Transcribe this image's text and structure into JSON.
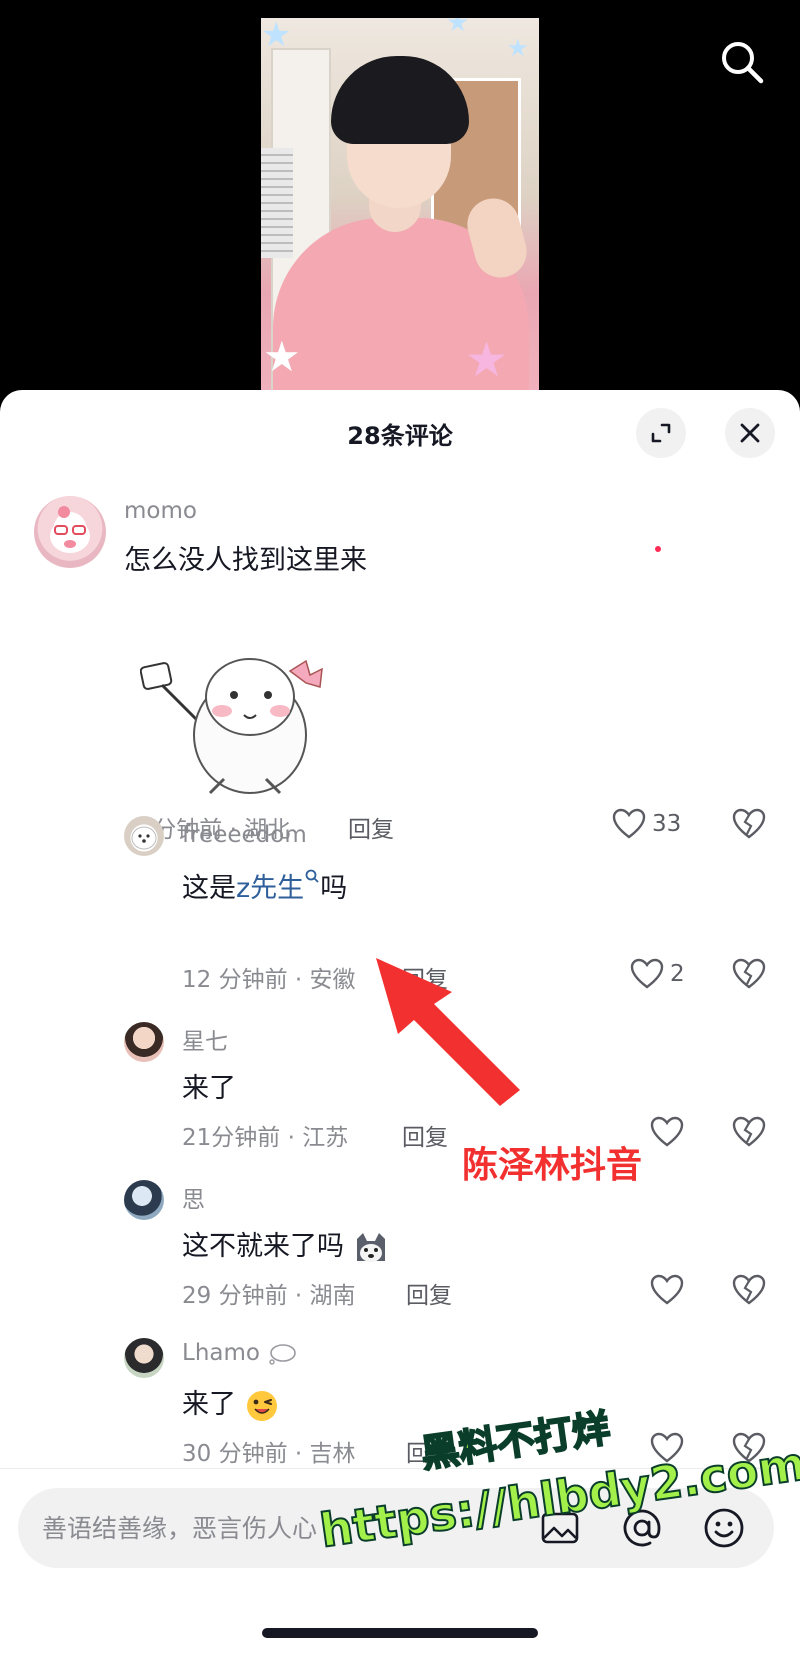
{
  "header": {
    "search_icon": "search-icon"
  },
  "sheet": {
    "title": "28条评论",
    "expand_icon": "expand-icon",
    "close_icon": "close-icon"
  },
  "comments": [
    {
      "username": "momo",
      "text": "怎么没人找到这里来",
      "time_location": "41分钟前 · 湖北",
      "reply_label": "回复",
      "likes": "33",
      "has_sticker": true
    },
    {
      "username": "freeeedom",
      "text_prefix": "这是",
      "mention": "z先生",
      "text_suffix": "吗",
      "time_location": "12 分钟前 · 安徽",
      "reply_label": "回复",
      "likes": "2"
    },
    {
      "username": "星七",
      "text": "来了",
      "time_location": "21分钟前 · 江苏",
      "reply_label": "回复",
      "likes": ""
    },
    {
      "username": "思",
      "text": "这不就来了吗",
      "time_location": "29 分钟前 · 湖南",
      "reply_label": "回复",
      "likes": ""
    },
    {
      "username": "Lhamo",
      "text": "来了",
      "time_location": "30 分钟前 · 吉林",
      "reply_label": "回复",
      "likes": ""
    }
  ],
  "annotation": {
    "label": "陈泽林抖音",
    "color": "#f2302f"
  },
  "watermark": {
    "line1": "黑料不打烊",
    "line2": "https://hlbdy2.com",
    "color": "#a4f04a"
  },
  "input": {
    "placeholder": "善语结善缘，恶言伤人心",
    "image_icon": "image-icon",
    "at_icon": "at-icon",
    "emoji_icon": "emoji-icon"
  },
  "colors": {
    "accent_red": "#fe2c55",
    "mention_blue": "#2f5f9a"
  }
}
